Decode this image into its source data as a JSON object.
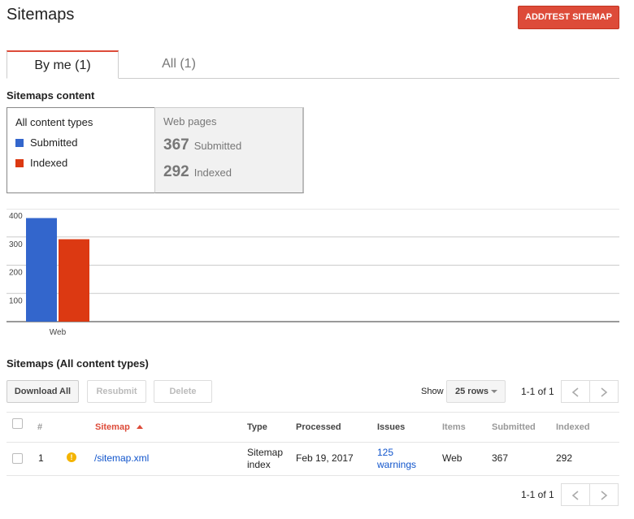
{
  "header": {
    "title": "Sitemaps",
    "add_button": "ADD/TEST SITEMAP"
  },
  "tabs": [
    {
      "label": "By me (1)",
      "active": true
    },
    {
      "label": "All (1)",
      "active": false
    }
  ],
  "content": {
    "section_title": "Sitemaps content",
    "filter": {
      "title": "All content types",
      "legend": [
        {
          "label": "Submitted",
          "color": "#3366cc"
        },
        {
          "label": "Indexed",
          "color": "#dc3912"
        }
      ]
    },
    "web_pages": {
      "title": "Web pages",
      "submitted_value": "367",
      "submitted_label": "Submitted",
      "indexed_value": "292",
      "indexed_label": "Indexed"
    }
  },
  "chart_data": {
    "type": "bar",
    "categories": [
      "Web"
    ],
    "series": [
      {
        "name": "Submitted",
        "values": [
          367
        ],
        "color": "#3366cc"
      },
      {
        "name": "Indexed",
        "values": [
          292
        ],
        "color": "#dc3912"
      }
    ],
    "yticks": [
      100,
      200,
      300,
      400
    ],
    "ylim": [
      0,
      400
    ],
    "grid": true
  },
  "table_section": {
    "title": "Sitemaps (All content types)",
    "download_all": "Download All",
    "resubmit": "Resubmit",
    "delete": "Delete",
    "show_label": "Show",
    "rows_select": "25 rows",
    "pager_top": "1-1 of 1",
    "pager_bottom": "1-1 of 1",
    "headers": {
      "num": "#",
      "sitemap": "Sitemap",
      "type": "Type",
      "processed": "Processed",
      "issues": "Issues",
      "items": "Items",
      "submitted": "Submitted",
      "indexed": "Indexed"
    },
    "rows": [
      {
        "num": "1",
        "sitemap": "/sitemap.xml",
        "type_line1": "Sitemap",
        "type_line2": "index",
        "processed": "Feb 19, 2017",
        "issues_line1": "125",
        "issues_line2": "warnings",
        "items": "Web",
        "submitted": "367",
        "indexed": "292"
      }
    ]
  }
}
